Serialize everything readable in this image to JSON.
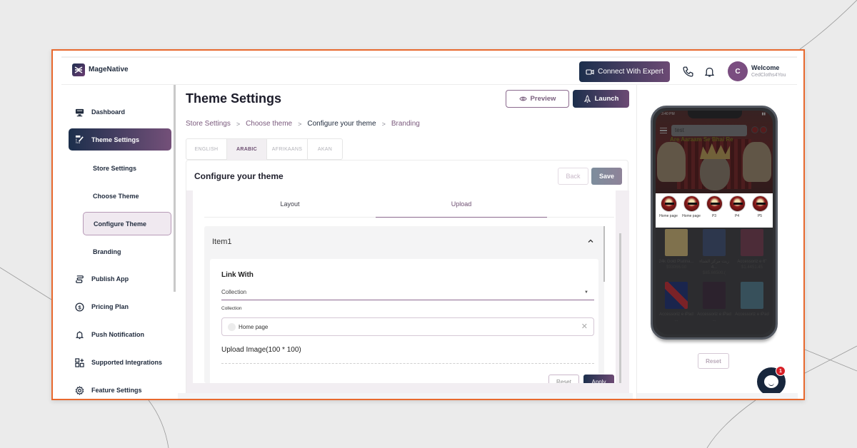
{
  "header": {
    "brand": "MageNative",
    "connect_label": "Connect With Expert",
    "welcome": "Welcome",
    "store_name": "CedCloths4You",
    "avatar_initial": "C",
    "icons": [
      "video-icon",
      "phone-icon",
      "bell-icon"
    ]
  },
  "sidebar": {
    "items": [
      {
        "label": "Dashboard",
        "icon": "dashboard-icon"
      },
      {
        "label": "Theme Settings",
        "icon": "theme-edit-icon",
        "active": true
      },
      {
        "label": "Publish App",
        "icon": "publish-icon"
      },
      {
        "label": "Pricing Plan",
        "icon": "dollar-circle-icon"
      },
      {
        "label": "Push Notification",
        "icon": "bell-icon"
      },
      {
        "label": "Supported Integrations",
        "icon": "integrations-icon"
      },
      {
        "label": "Feature Settings",
        "icon": "gear-icon"
      }
    ],
    "sub_items": [
      {
        "label": "Store Settings"
      },
      {
        "label": "Choose Theme"
      },
      {
        "label": "Configure Theme",
        "active": true
      },
      {
        "label": "Branding"
      }
    ]
  },
  "main": {
    "title": "Theme Settings",
    "preview_label": "Preview",
    "launch_label": "Launch",
    "breadcrumb": [
      {
        "label": "Store Settings",
        "current": false
      },
      {
        "label": "Choose theme",
        "current": false
      },
      {
        "label": "Configure your theme",
        "current": true
      },
      {
        "label": "Branding",
        "current": false
      }
    ],
    "languages": [
      {
        "label": "ENGLISH",
        "active": false
      },
      {
        "label": "ARABIC",
        "active": true
      },
      {
        "label": "AFRIKAANS",
        "active": false
      },
      {
        "label": "AKAN",
        "active": false
      }
    ],
    "config": {
      "title": "Configure your theme",
      "back_label": "Back",
      "save_label": "Save",
      "tabs": [
        {
          "label": "Layout",
          "active": false
        },
        {
          "label": "Upload",
          "active": true
        }
      ],
      "accordion_title": "Item1",
      "link_with_label": "Link With",
      "link_with_value": "Collection",
      "collection_label": "Collection",
      "collection_value": "Home page",
      "upload_label": "Upload Image(100 * 100)",
      "reset_label": "Reset",
      "apply_label": "Apply"
    }
  },
  "preview": {
    "status_time": "3:40 PM",
    "search_text": "test",
    "banner_title": "Are Aaraam Se Bhai Re",
    "circles": [
      {
        "label": "Home page"
      },
      {
        "label": "Home page"
      },
      {
        "label": "P3"
      },
      {
        "label": "P4"
      },
      {
        "label": "P5"
      }
    ],
    "products": [
      {
        "title": "24k Gold Platina...",
        "price": "$93066.00",
        "color": "#b8a46a"
      },
      {
        "title": "زيت مركز الشتاء ...4",
        "price": "$85.66500.(",
        "color": "#3b4a6a"
      },
      {
        "title": "Accessoriz e 6\"",
        "price": "$1.4451.45",
        "color": "#6a3a4a"
      },
      {
        "title": "Accessoriz e iPad ...",
        "price": "",
        "color": "#7a2630"
      },
      {
        "title": "Accessoriz e iPad ...",
        "price": "",
        "color": "#3a2a3a"
      },
      {
        "title": "Accessoriz e iPad",
        "price": "",
        "color": "#4a7080"
      }
    ],
    "reset_label": "Reset",
    "chat_badge": "1"
  },
  "colors": {
    "accent_dark": "#1c2f4c",
    "accent_purple": "#6c4a74",
    "frame_border": "#e8692e",
    "badge_red": "#d71f26"
  }
}
